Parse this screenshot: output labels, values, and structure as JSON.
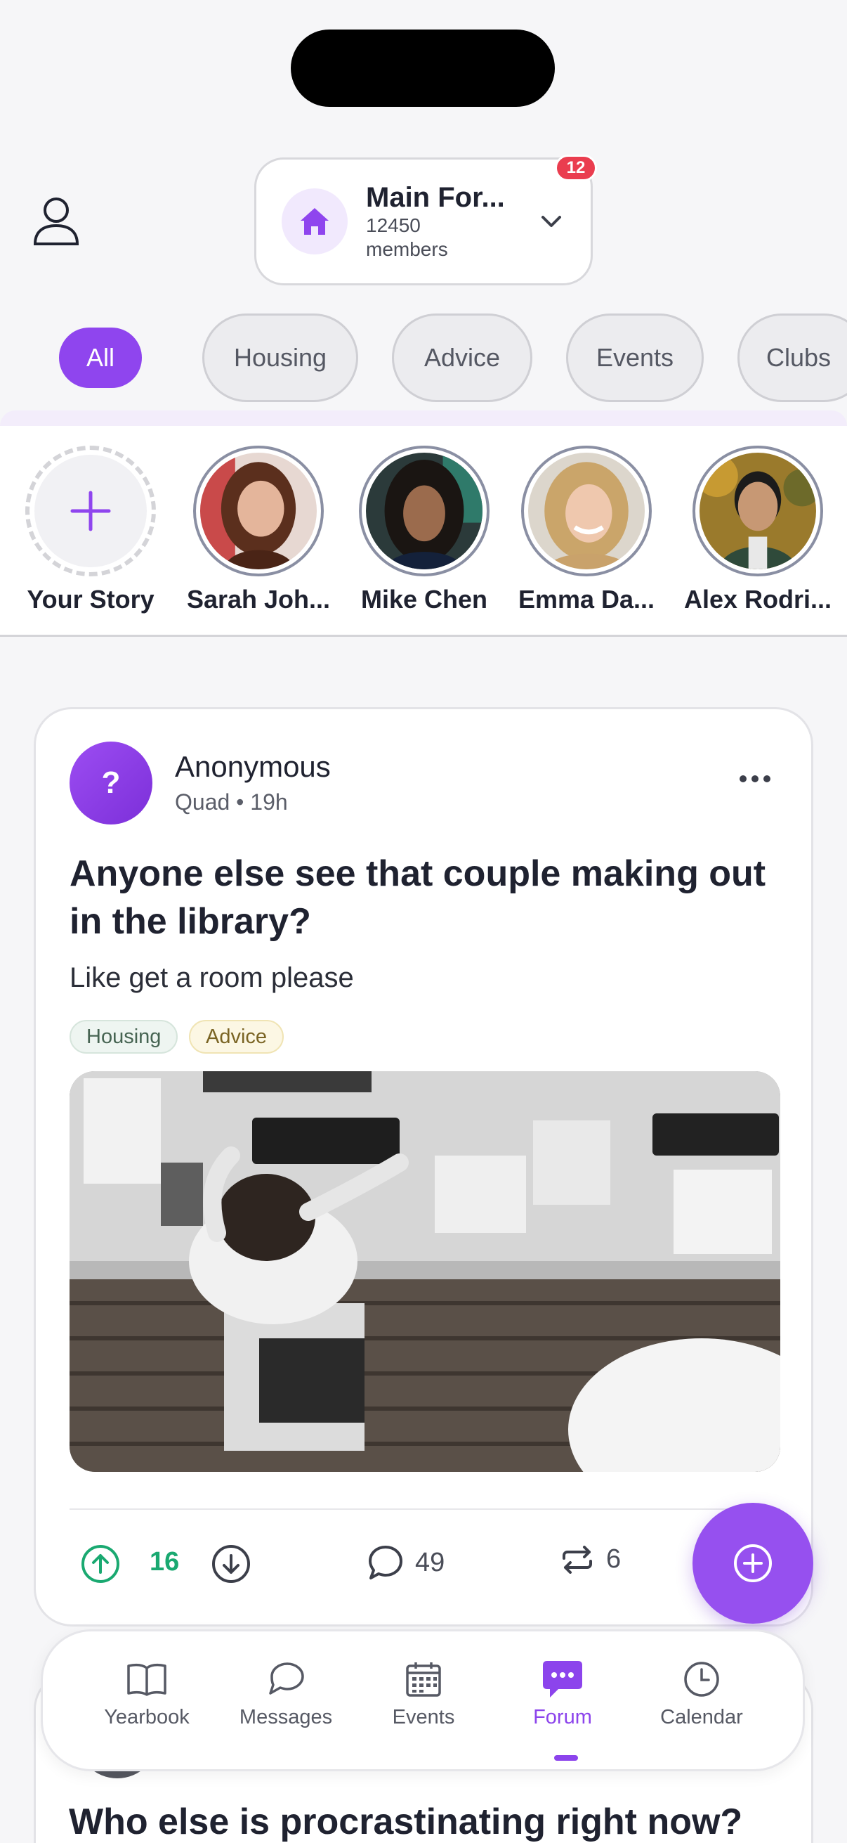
{
  "header": {
    "forum_name": "Main For...",
    "members_count": "12450",
    "members_label": "members",
    "notification_count": "12"
  },
  "categories": [
    "All",
    "Housing",
    "Advice",
    "Events",
    "Clubs"
  ],
  "stories": {
    "your_story_label": "Your Story",
    "people": [
      "Sarah Joh...",
      "Mike Chen",
      "Emma Da...",
      "Alex Rodri..."
    ]
  },
  "post": {
    "author": "Anonymous",
    "avatar_letter": "?",
    "meta": "Quad • 19h",
    "title": "Anyone else see that couple making out in the library?",
    "body": "Like get a room please",
    "tags": [
      "Housing",
      "Advice"
    ],
    "upvotes": "16",
    "comments": "49",
    "reposts": "6"
  },
  "next_post": {
    "title": "Who else is procrastinating right now?"
  },
  "bottom_nav": {
    "items": [
      "Yearbook",
      "Messages",
      "Events",
      "Forum",
      "Calendar"
    ],
    "active": "Forum"
  },
  "colors": {
    "accent": "#8f45ee",
    "upvote": "#1aa971",
    "badge": "#ea3d4f"
  }
}
